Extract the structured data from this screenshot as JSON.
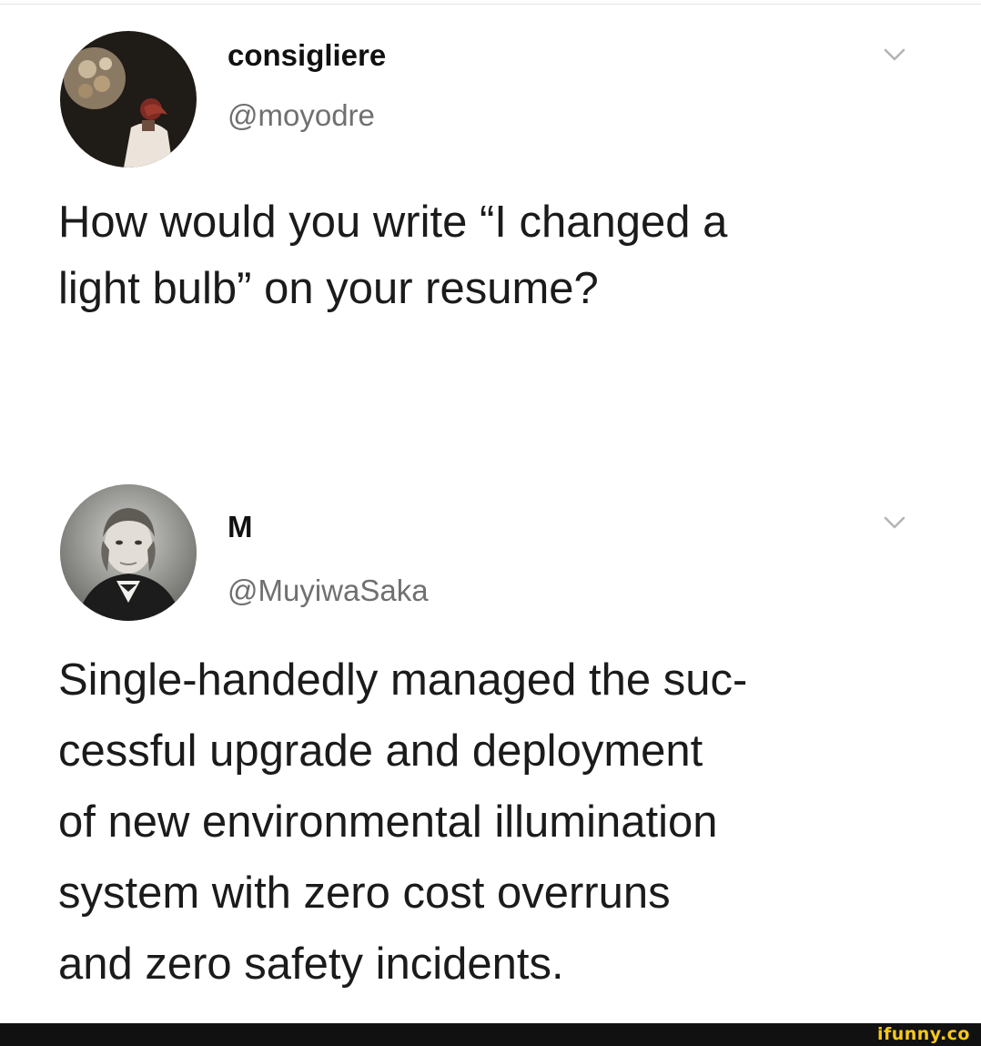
{
  "tweets": [
    {
      "avatar_icon": "avatar-illustration-icon",
      "display_name": "consigliere",
      "handle": "@moyodre",
      "text": "How would you write “I changed a\nlight bulb” on your resume?"
    },
    {
      "avatar_icon": "avatar-portrait-icon",
      "display_name": "M",
      "handle": "@MuyiwaSaka",
      "text": "Single-handedly managed the suc-\ncessful upgrade and deployment\nof new environmental illumination\nsystem with zero cost overruns\nand zero safety incidents."
    }
  ],
  "icons": {
    "more": "chevron-down-icon"
  },
  "watermark": "ifunny.co",
  "colors": {
    "text": "#1b1b1b",
    "handle": "#707070",
    "watermark": "#f7c81a",
    "footer": "#111111"
  }
}
